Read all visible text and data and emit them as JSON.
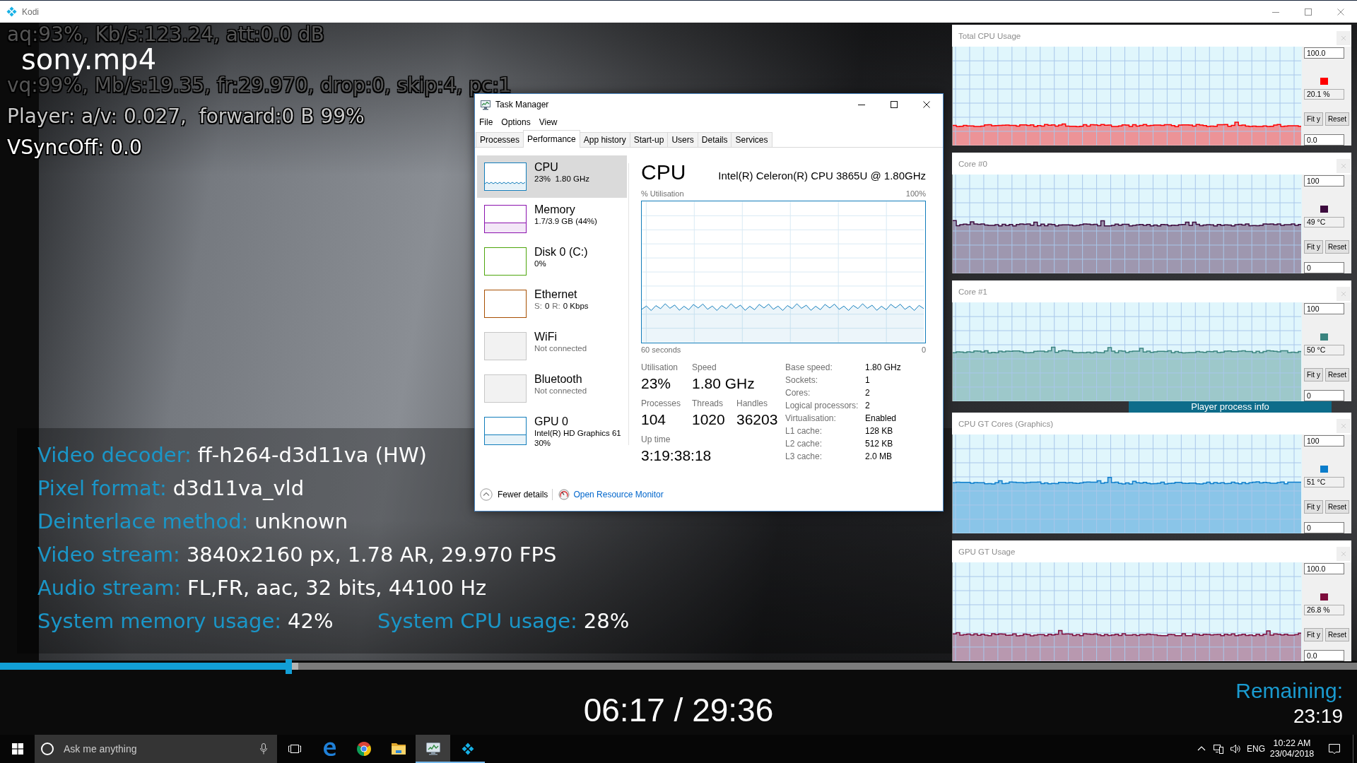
{
  "window": {
    "title": "Kodi"
  },
  "overlay": {
    "audio": "aq:93%, Kb/s:123.24, att:0.0 dB",
    "file_name": "sony.mp4",
    "video": "vq:99%, Mb/s:19.35, fr:29.970, drop:0, skip:4, pc:1",
    "player": "Player: a/v: 0.027,  forward:0 B 99%",
    "vsync": "VSyncOff: 0.0"
  },
  "task_manager": {
    "title": "Task Manager",
    "menu": [
      "File",
      "Options",
      "View"
    ],
    "tabs": [
      {
        "label": "Processes",
        "selected": false
      },
      {
        "label": "Performance",
        "selected": true
      },
      {
        "label": "App history",
        "selected": false
      },
      {
        "label": "Start-up",
        "selected": false
      },
      {
        "label": "Users",
        "selected": false
      },
      {
        "label": "Details",
        "selected": false
      },
      {
        "label": "Services",
        "selected": false
      }
    ],
    "resources": [
      {
        "name": "CPU",
        "details": [
          "23%  1.80 GHz"
        ],
        "kind": "line",
        "color": "#117dbb",
        "connected": true,
        "selected": true
      },
      {
        "name": "Memory",
        "details": [
          "1.7/3.9 GB (44%)"
        ],
        "kind": "area",
        "color": "#8b12ae",
        "connected": true,
        "selected": false
      },
      {
        "name": "Disk 0 (C:)",
        "details": [
          "0%"
        ],
        "kind": "blank",
        "color": "#4da60c",
        "connected": true,
        "selected": false
      },
      {
        "name": "Ethernet",
        "rates": [
          {
            "label": "S:",
            "value": "0"
          },
          {
            "label": "R:",
            "value": "0 Kbps"
          }
        ],
        "kind": "blank",
        "color": "#a74f01",
        "connected": true,
        "selected": false
      },
      {
        "name": "WiFi",
        "details": [
          "Not connected"
        ],
        "kind": "blank",
        "connected": false,
        "selected": false
      },
      {
        "name": "Bluetooth",
        "details": [
          "Not connected"
        ],
        "kind": "blank",
        "connected": false,
        "selected": false
      },
      {
        "name": "GPU 0",
        "details": [
          "Intel(R) HD Graphics 61",
          "30%"
        ],
        "kind": "area",
        "color": "#117dbb",
        "connected": true,
        "selected": false
      }
    ],
    "heading": "CPU",
    "model": "Intel(R) Celeron(R) CPU 3865U @ 1.80GHz",
    "graph": {
      "y_label": "% Utilisation",
      "y_max": "100%",
      "x_start": "60 seconds",
      "x_end": "0"
    },
    "stat_rows": [
      [
        {
          "label": "Utilisation",
          "value": "23%"
        },
        {
          "label": "Speed",
          "value": "1.80 GHz"
        }
      ],
      [
        {
          "label": "Processes",
          "value": "104"
        },
        {
          "label": "Threads",
          "value": "1020"
        },
        {
          "label": "Handles",
          "value": "36203"
        }
      ],
      [
        {
          "label": "Up time",
          "value": "3:19:38:18"
        }
      ]
    ],
    "specs": [
      {
        "label": "Base speed:",
        "value": "1.80 GHz"
      },
      {
        "label": "Sockets:",
        "value": "1"
      },
      {
        "label": "Cores:",
        "value": "2"
      },
      {
        "label": "Logical processors:",
        "value": "2"
      },
      {
        "label": "Virtualisation:",
        "value": "Enabled"
      },
      {
        "label": "L1 cache:",
        "value": "128 KB"
      },
      {
        "label": "L2 cache:",
        "value": "512 KB"
      },
      {
        "label": "L3 cache:",
        "value": "2.0 MB"
      }
    ],
    "fewer_details": "Fewer details",
    "resource_monitor": "Open Resource Monitor"
  },
  "graph_windows": [
    {
      "kind": "panel",
      "title": "Total CPU Usage",
      "max": "100.0",
      "reading": "20.1 %",
      "min": "0.0",
      "color": "#ff0000",
      "buttons": [
        "Fit y",
        "Reset"
      ]
    },
    {
      "kind": "panel",
      "title": "Core #0",
      "max": "100",
      "reading": "49 °C",
      "min": "0",
      "color": "#3c0a3d",
      "buttons": [
        "Fit y",
        "Reset"
      ]
    },
    {
      "kind": "panel",
      "title": "Core #1",
      "max": "100",
      "reading": "50 °C",
      "min": "0",
      "color": "#3a847f",
      "buttons": [
        "Fit y",
        "Reset"
      ]
    },
    {
      "kind": "banner",
      "title": "Player process info"
    },
    {
      "kind": "panel",
      "title": "CPU GT Cores (Graphics)",
      "max": "100",
      "reading": "51 °C",
      "min": "0",
      "color": "#0b7dcb",
      "buttons": [
        "Fit y",
        "Reset"
      ]
    },
    {
      "kind": "panel",
      "title": "GPU GT Usage",
      "max": "100.0",
      "reading": "26.8 %",
      "min": "0.0",
      "color": "#7d0c3c",
      "buttons": [
        "Fit y",
        "Reset"
      ]
    }
  ],
  "info": [
    [
      {
        "label": "Video decoder:",
        "value": "ff-h264-d3d11va (HW)"
      }
    ],
    [
      {
        "label": "Pixel format:",
        "value": "d3d11va_vld"
      }
    ],
    [
      {
        "label": "Deinterlace method:",
        "value": "unknown"
      }
    ],
    [
      {
        "label": "Video stream:",
        "value": "3840x2160 px, 1.78 AR, 29.970 FPS"
      }
    ],
    [
      {
        "label": "Audio stream:",
        "value": "FL,FR, aac, 32 bits, 44100 Hz"
      }
    ],
    [
      {
        "label": "System memory usage:",
        "value": "42%"
      },
      {
        "label": "System CPU usage:",
        "value": "28%"
      }
    ]
  ],
  "playback": {
    "progress": {
      "level": 0.2123
    },
    "buffer": {
      "level": 0.22
    },
    "time": "06:17 / 29:36",
    "remaining_label": "Remaining:",
    "remaining": "23:19"
  },
  "taskbar": {
    "search": {
      "placeholder": "Ask me anything"
    },
    "apps": [
      {
        "kind": "edge",
        "running": false,
        "selected": false
      },
      {
        "kind": "chrome",
        "running": false,
        "selected": false
      },
      {
        "kind": "explorer",
        "running": false,
        "selected": false
      },
      {
        "kind": "task-manager",
        "running": true,
        "selected": true
      },
      {
        "kind": "kodi",
        "running": true,
        "selected": false
      }
    ],
    "language": "ENG",
    "time": "10:22 AM",
    "date": "23/04/2018"
  }
}
